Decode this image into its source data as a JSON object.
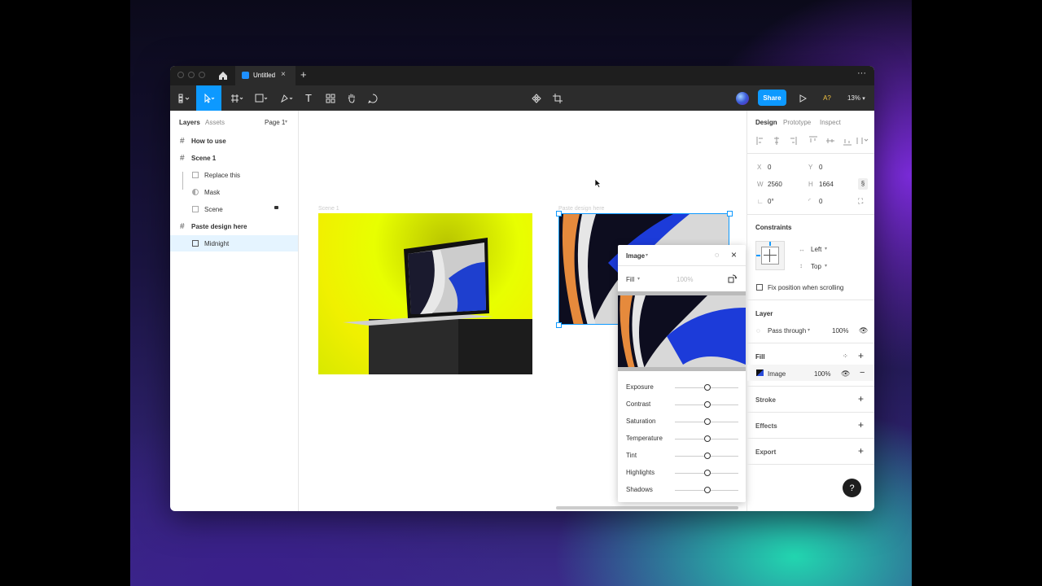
{
  "tab": {
    "title": "Untitled"
  },
  "toolbar": {
    "share_label": "Share",
    "zoom": "13%",
    "user_initials": "A?"
  },
  "left_panel": {
    "tabs": [
      "Layers",
      "Assets"
    ],
    "page": "Page 1",
    "layers": [
      {
        "label": "How to use",
        "bold": true
      },
      {
        "label": "Scene 1",
        "bold": true
      },
      {
        "label": "Replace this",
        "bold": false
      },
      {
        "label": "Mask",
        "bold": false
      },
      {
        "label": "Scene",
        "bold": false
      },
      {
        "label": "Paste design here",
        "bold": true
      },
      {
        "label": "Midnight",
        "bold": false
      }
    ]
  },
  "canvas": {
    "frame1_label": "Scene 1",
    "frame2_label": "Paste design here"
  },
  "right_panel": {
    "tabs": [
      "Design",
      "Prototype",
      "Inspect"
    ],
    "x_label": "X",
    "x": "0",
    "y_label": "Y",
    "y": "0",
    "w_label": "W",
    "w": "2560",
    "h_label": "H",
    "h": "1664",
    "rotation": "0°",
    "radius": "0",
    "constraints_title": "Constraints",
    "constraint_h": "Left",
    "constraint_v": "Top",
    "fix_position": "Fix position when scrolling",
    "layer_title": "Layer",
    "blend": "Pass through",
    "opacity": "100%",
    "fill_title": "Fill",
    "fill_type": "Image",
    "fill_opacity": "100%",
    "stroke_title": "Stroke",
    "effects_title": "Effects",
    "export_title": "Export"
  },
  "popup": {
    "title": "Image",
    "mode": "Fill",
    "opacity": "100%",
    "adjustments": [
      "Exposure",
      "Contrast",
      "Saturation",
      "Temperature",
      "Tint",
      "Highlights",
      "Shadows"
    ]
  },
  "colors": {
    "accent": "#0d99ff",
    "selection": "#e5f4ff"
  }
}
